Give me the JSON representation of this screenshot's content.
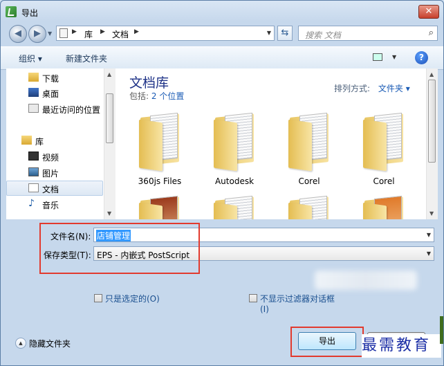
{
  "window": {
    "title": "导出",
    "close_label": "✕",
    "app_icon": "document-export-icon"
  },
  "navbar": {
    "back_icon": "back-arrow-icon",
    "forward_icon": "forward-arrow-icon",
    "breadcrumb": [
      "库",
      "文档"
    ],
    "search_placeholder": "搜索 文档"
  },
  "toolbar": {
    "organize_label": "组织 ▾",
    "new_folder_label": "新建文件夹",
    "help_label": "?"
  },
  "navpane": {
    "items": [
      {
        "label": "下载",
        "icon": "download-folder-icon"
      },
      {
        "label": "桌面",
        "icon": "desktop-icon"
      },
      {
        "label": "最近访问的位置",
        "icon": "recent-places-icon"
      },
      {
        "label": "库",
        "icon": "libraries-icon"
      },
      {
        "label": "视频",
        "icon": "videos-icon"
      },
      {
        "label": "图片",
        "icon": "pictures-icon"
      },
      {
        "label": "文档",
        "icon": "documents-icon",
        "selected": true
      },
      {
        "label": "音乐",
        "icon": "music-icon"
      }
    ]
  },
  "content": {
    "library_title": "文档库",
    "includes_prefix": "包括:",
    "includes_link": "2 个位置",
    "arrange_label": "排列方式:",
    "arrange_value": "文件夹 ▾",
    "folders": [
      {
        "name": "360js Files"
      },
      {
        "name": "Autodesk"
      },
      {
        "name": "Corel"
      },
      {
        "name": "Corel"
      },
      {
        "name": ""
      },
      {
        "name": ""
      },
      {
        "name": ""
      },
      {
        "name": ""
      }
    ]
  },
  "form": {
    "filename_label": "文件名(N):",
    "filename_value": "店铺管理",
    "filetype_label": "保存类型(T):",
    "filetype_value": "EPS - 内嵌式 PostScript",
    "only_selected_label": "只是选定的(O)",
    "no_filter_label_line1": "不显示过滤器对话框",
    "no_filter_label_line2": "(I)"
  },
  "footer": {
    "hide_folders_label": "隐藏文件夹",
    "export_label": "导出",
    "watermark_text": "最需教育"
  },
  "colors": {
    "highlight_box": "#e23a2e",
    "title_blue": "#1e3287",
    "link_blue": "#1a5bb5"
  }
}
